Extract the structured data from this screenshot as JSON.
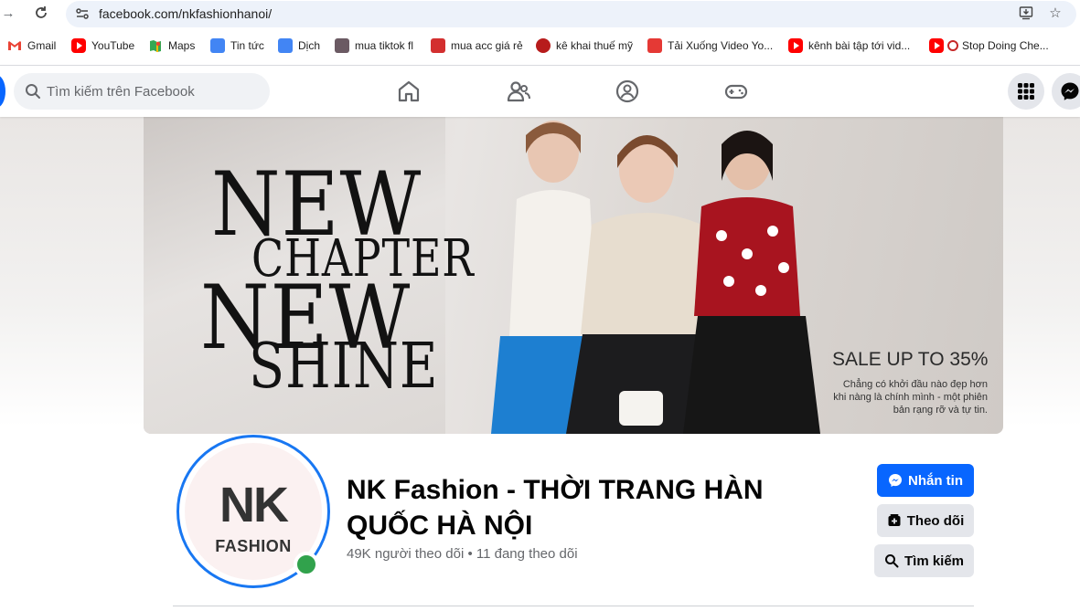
{
  "browser": {
    "url": "facebook.com/nkfashionhanoi/",
    "bookmarks": [
      {
        "label": "Gmail",
        "icon": "gmail-icon"
      },
      {
        "label": "YouTube",
        "icon": "youtube-icon"
      },
      {
        "label": "Maps",
        "icon": "maps-icon"
      },
      {
        "label": "Tin tức",
        "icon": "news-icon"
      },
      {
        "label": "Dịch",
        "icon": "translate-icon"
      },
      {
        "label": "mua tiktok fl",
        "icon": "site-icon"
      },
      {
        "label": "mua acc giá rẻ",
        "icon": "site-icon"
      },
      {
        "label": "kê khai thuế mỹ",
        "icon": "site-icon"
      },
      {
        "label": "Tải Xuống Video Yo...",
        "icon": "download-icon"
      },
      {
        "label": "kênh bài tập tới vid...",
        "icon": "youtube-icon"
      },
      {
        "label": "Stop Doing Che...",
        "icon": "youtube-icon"
      }
    ]
  },
  "facebook": {
    "search_placeholder": "Tìm kiếm trên Facebook"
  },
  "cover": {
    "line1": "NEW",
    "line2": "CHAPTER",
    "line3": "NEW",
    "line4": "SHINE",
    "sale": "SALE UP TO 35%",
    "sale_desc": "Chẳng có khởi đầu nào đẹp hơn khi nàng là chính mình - một phiên bản rạng rỡ và tự tin."
  },
  "profile": {
    "logo_mark": "NK",
    "logo_text": "FASHION",
    "name": "NK Fashion - THỜI TRANG HÀN QUỐC HÀ NỘI",
    "stats": "49K người theo dõi • 11 đang theo dõi",
    "buttons": {
      "message": "Nhắn tin",
      "follow": "Theo dõi",
      "search": "Tìm kiếm"
    }
  },
  "colors": {
    "fb_blue": "#0866ff",
    "online": "#31a24c",
    "ring": "#1877f2"
  }
}
